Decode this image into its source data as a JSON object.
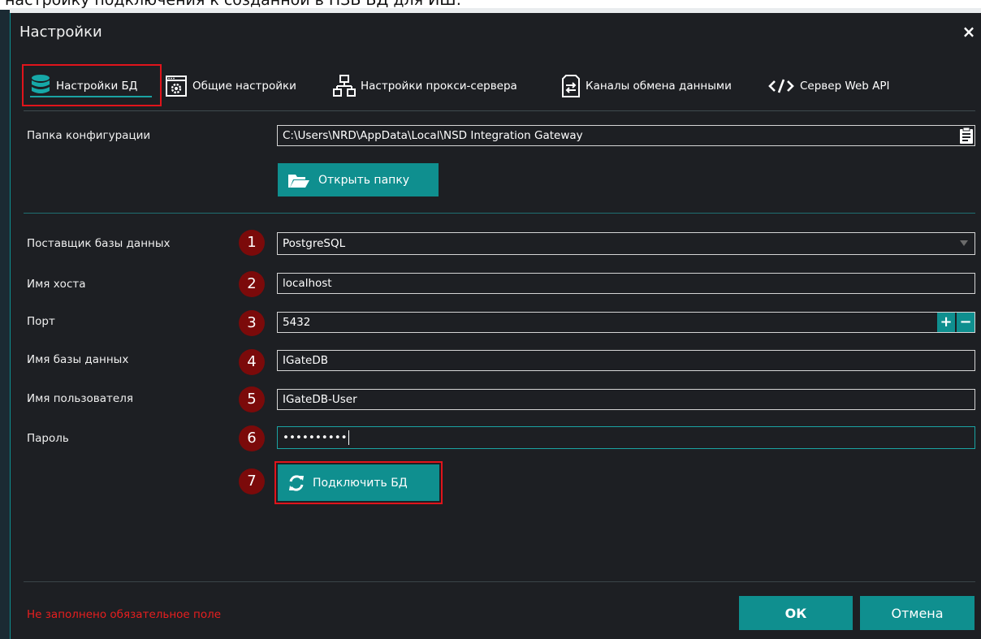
{
  "doc_text": "настройку подключения к созданной в НЗБ БД для ИШ:",
  "window": {
    "title": "Настройки",
    "close_glyph": "×"
  },
  "tabs": [
    {
      "label": "Настройки БД",
      "icon": "database-icon"
    },
    {
      "label": "Общие настройки",
      "icon": "settings-window-icon"
    },
    {
      "label": "Настройки прокси-сервера",
      "icon": "network-icon"
    },
    {
      "label": "Каналы обмена данными",
      "icon": "file-exchange-icon"
    },
    {
      "label": "Сервер Web API",
      "icon": "code-icon"
    }
  ],
  "config": {
    "label": "Папка конфигурации",
    "value": "C:\\Users\\NRD\\AppData\\Local\\NSD Integration Gateway",
    "open_folder_label": "Открыть папку"
  },
  "form": {
    "provider": {
      "num": "1",
      "label": "Поставщик базы данных",
      "value": "PostgreSQL"
    },
    "host": {
      "num": "2",
      "label": "Имя хоста",
      "value": "localhost"
    },
    "port": {
      "num": "3",
      "label": "Порт",
      "value": "5432",
      "plus": "+",
      "minus": "−"
    },
    "dbname": {
      "num": "4",
      "label": "Имя базы данных",
      "value": "IGateDB"
    },
    "user": {
      "num": "5",
      "label": "Имя пользователя",
      "value": "IGateDB-User"
    },
    "password": {
      "num": "6",
      "label": "Пароль",
      "value": "••••••••••"
    },
    "connect": {
      "num": "7",
      "label": "Подключить БД"
    }
  },
  "footer": {
    "error": "Не заполнено обязательное поле",
    "ok": "ОК",
    "cancel": "Отмена"
  },
  "colors": {
    "accent": "#0f8f8f",
    "highlight": "#e0141b",
    "badge": "#7b0a0a",
    "error": "#e81f1f"
  }
}
